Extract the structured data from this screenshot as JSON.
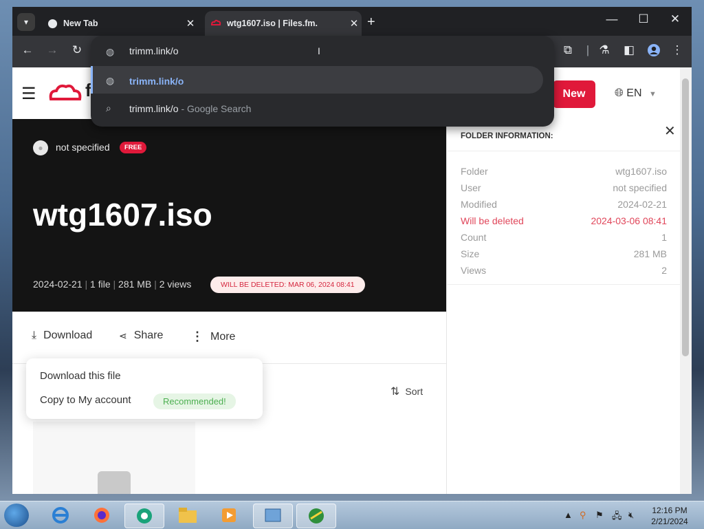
{
  "browser": {
    "tabs": [
      {
        "title": "New Tab",
        "active": false
      },
      {
        "title": "wtg1607.iso | Files.fm.",
        "active": true
      }
    ],
    "omnibox": {
      "input": "trimm.link/o",
      "suggestions": [
        {
          "text": "trimm.link/o",
          "suffix": "",
          "icon": "globe-icon",
          "selected": true
        },
        {
          "text": "trimm.link/o",
          "suffix": " - Google Search",
          "icon": "search-icon",
          "selected": false
        }
      ]
    }
  },
  "page": {
    "header": {
      "logo_char": "f",
      "new_button": "New",
      "language": "EN"
    },
    "hero": {
      "owner": "not specified",
      "plan_badge": "FREE",
      "title": "wtg1607.iso",
      "meta": {
        "date": "2024-02-21",
        "files": "1 file",
        "size": "281 MB",
        "views": "2 views"
      },
      "deletion_badge": "WILL BE DELETED: MAR 06, 2024 08:41"
    },
    "actions": {
      "download": "Download",
      "share": "Share",
      "more": "More"
    },
    "dropdown": {
      "download_this_file": "Download this file",
      "copy_to_account": "Copy to My account",
      "recommended": "Recommended!"
    },
    "sort_label": "Sort",
    "folder_info": {
      "title": "FOLDER INFORMATION:",
      "rows": [
        {
          "label": "Folder",
          "value": "wtg1607.iso",
          "highlight": false
        },
        {
          "label": "User",
          "value": "not specified",
          "highlight": false
        },
        {
          "label": "Modified",
          "value": "2024-02-21",
          "highlight": false
        },
        {
          "label": "Will be deleted",
          "value": "2024-03-06 08:41",
          "highlight": true
        },
        {
          "label": "Count",
          "value": "1",
          "highlight": false
        },
        {
          "label": "Size",
          "value": "281 MB",
          "highlight": false
        },
        {
          "label": "Views",
          "value": "2",
          "highlight": false
        }
      ]
    }
  },
  "taskbar": {
    "time": "12:16 PM",
    "date": "2/21/2024"
  },
  "colors": {
    "brand_red": "#e0193a",
    "omnibox_blue": "#8ab4f8"
  }
}
